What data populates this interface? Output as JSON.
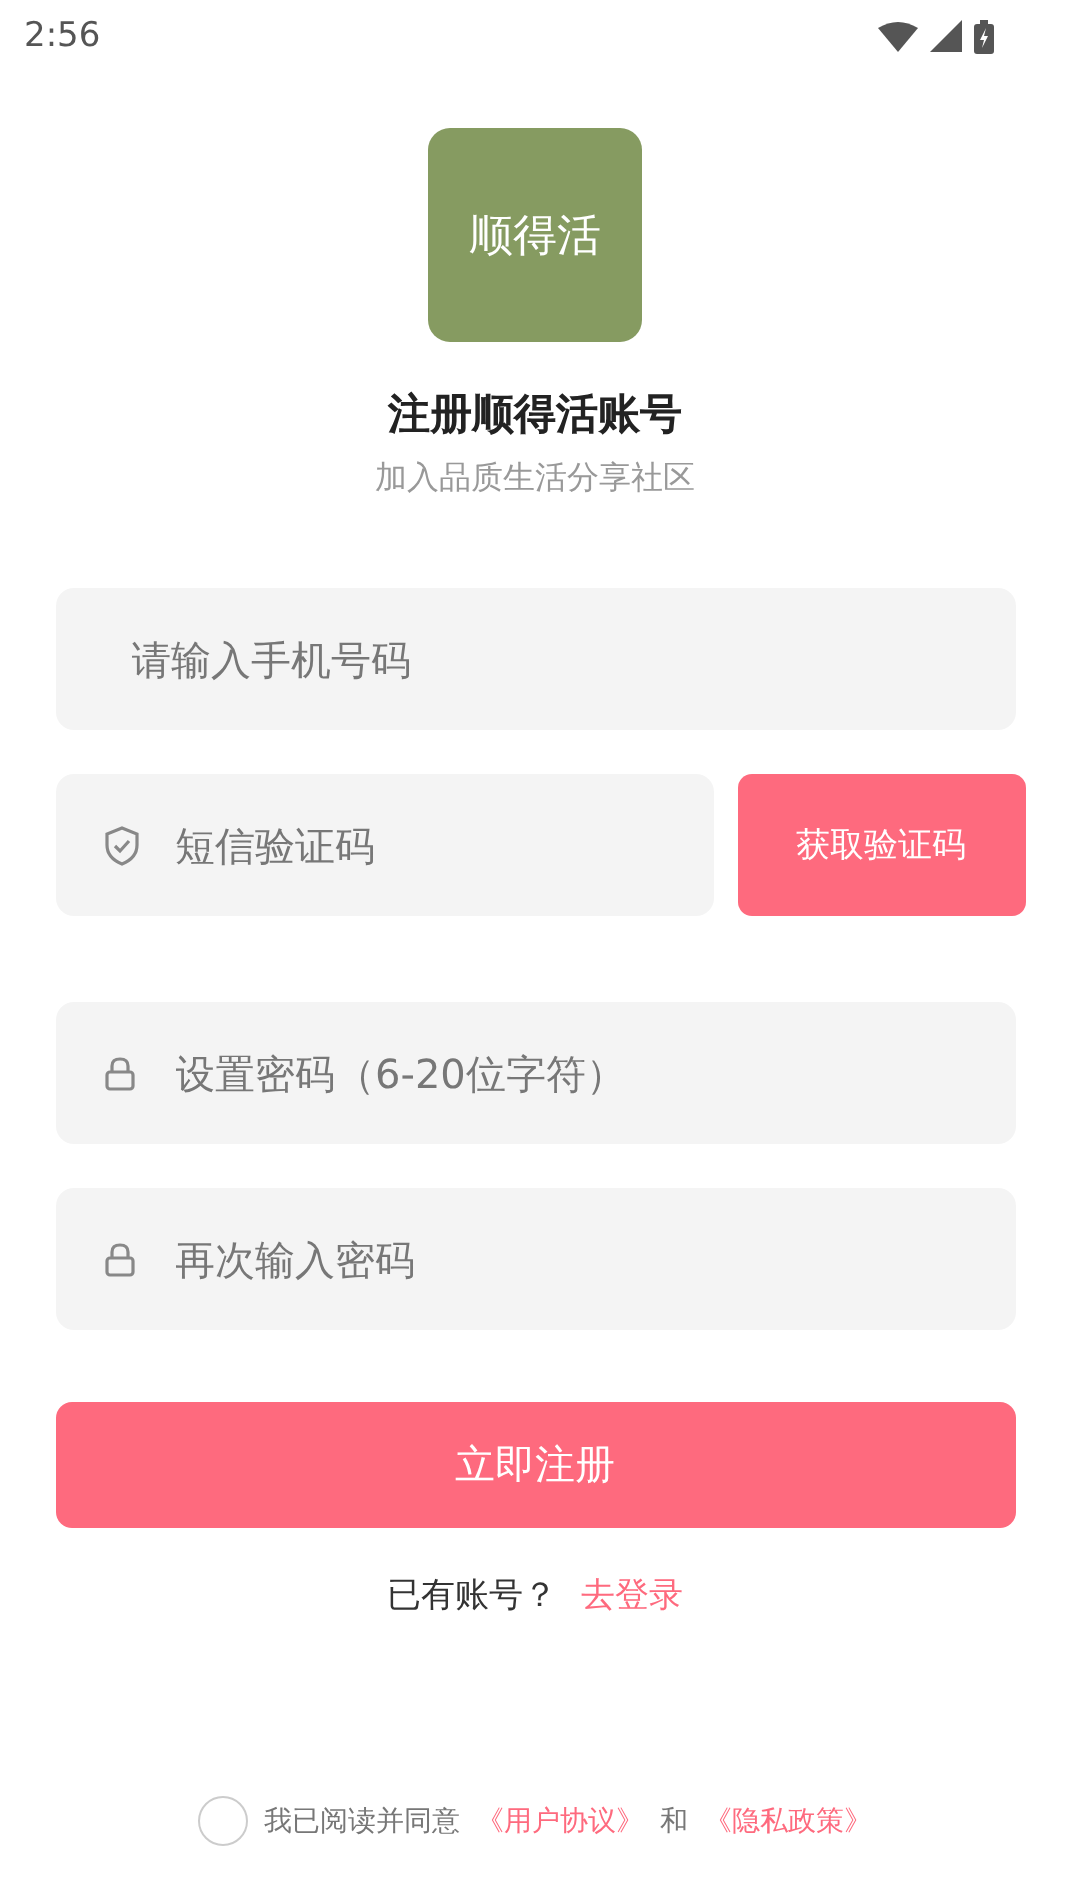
{
  "status_bar": {
    "time": "2:56"
  },
  "logo": {
    "text": "顺得活"
  },
  "title": "注册顺得活账号",
  "subtitle": "加入品质生活分享社区",
  "fields": [
    {
      "kind": "phone",
      "placeholder": "请输入手机号码"
    },
    {
      "kind": "code",
      "placeholder": "短信验证码",
      "button": "获取验证码"
    },
    {
      "kind": "password",
      "placeholder": "设置密码（6-20位字符）"
    },
    {
      "kind": "password",
      "placeholder": "再次输入密码"
    }
  ],
  "submit": "立即注册",
  "login": {
    "prompt": "已有账号？",
    "link": "去登录"
  },
  "agreement": {
    "checked": false,
    "text": "我已阅读并同意",
    "terms": "《用户协议》",
    "and": "和",
    "privacy": "《隐私政策》"
  }
}
